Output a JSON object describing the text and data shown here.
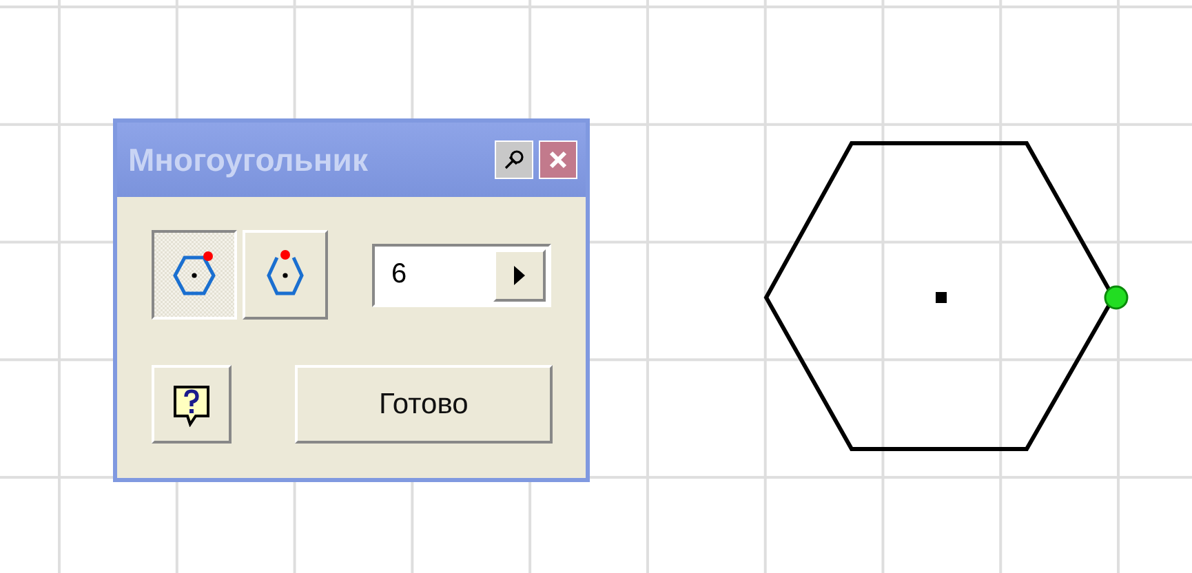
{
  "dialog": {
    "title": "Многоугольник",
    "modes": [
      {
        "selected": true
      },
      {
        "selected": false
      }
    ],
    "sides": {
      "value": "6"
    },
    "done_button": {
      "label": "Готово"
    }
  }
}
